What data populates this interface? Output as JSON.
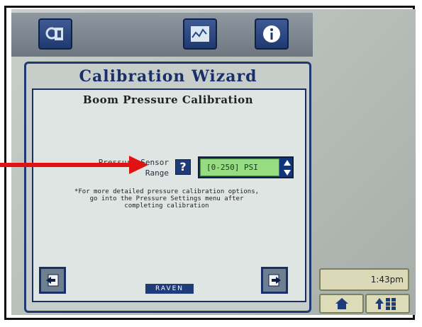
{
  "top_icons": {
    "setup": "settings-tool-icon",
    "graph": "graph-monitor-icon",
    "info": "info-icon"
  },
  "wizard": {
    "title": "Calibration Wizard",
    "subtitle": "Boom Pressure Calibration",
    "range_label_line1": "Pressure Sensor",
    "range_label_line2": "Range",
    "help_label": "?",
    "range_value": "[0-250] PSI",
    "note_line1": "*For more detailed pressure calibration options,",
    "note_line2": "go into the Pressure Settings menu after",
    "note_line3": "completing calibration",
    "back_icon": "back-page-icon",
    "next_icon": "next-page-icon",
    "brand": "RAVEN"
  },
  "status": {
    "time": "1:43pm",
    "home_icon": "home-icon",
    "menu_icon": "arrow-grid-icon"
  },
  "colors": {
    "wizard_title": "#1a2f6a",
    "range_field": "#96dd82",
    "annotation_arrow": "#e01212"
  }
}
